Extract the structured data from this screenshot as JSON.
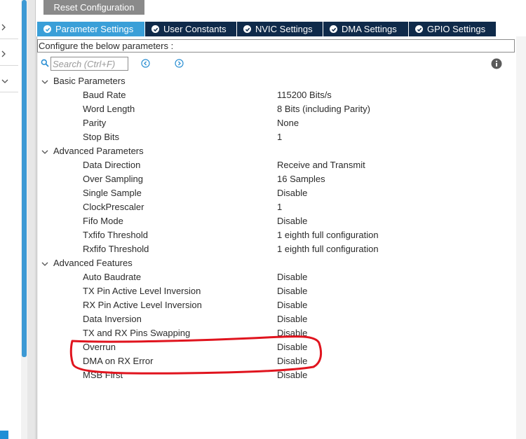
{
  "toolbar": {
    "reset_label": "Reset Configuration"
  },
  "tabs": [
    {
      "label": "Parameter Settings",
      "active": true
    },
    {
      "label": "User Constants",
      "active": false
    },
    {
      "label": "NVIC Settings",
      "active": false
    },
    {
      "label": "DMA Settings",
      "active": false
    },
    {
      "label": "GPIO Settings",
      "active": false
    }
  ],
  "description": "Configure the below parameters :",
  "search": {
    "placeholder": "Search (Ctrl+F)",
    "value": ""
  },
  "groups": [
    {
      "label": "Basic Parameters",
      "params": [
        {
          "name": "Baud Rate",
          "value": "115200 Bits/s"
        },
        {
          "name": "Word Length",
          "value": "8 Bits (including Parity)"
        },
        {
          "name": "Parity",
          "value": "None"
        },
        {
          "name": "Stop Bits",
          "value": "1"
        }
      ]
    },
    {
      "label": "Advanced Parameters",
      "params": [
        {
          "name": "Data Direction",
          "value": "Receive and Transmit"
        },
        {
          "name": "Over Sampling",
          "value": "16 Samples"
        },
        {
          "name": "Single Sample",
          "value": "Disable"
        },
        {
          "name": "ClockPrescaler",
          "value": "1"
        },
        {
          "name": "Fifo Mode",
          "value": "Disable"
        },
        {
          "name": "Txfifo Threshold",
          "value": "1 eighth full configuration"
        },
        {
          "name": "Rxfifo Threshold",
          "value": "1 eighth full configuration"
        }
      ]
    },
    {
      "label": "Advanced Features",
      "params": [
        {
          "name": "Auto Baudrate",
          "value": "Disable"
        },
        {
          "name": "TX Pin Active Level Inversion",
          "value": "Disable"
        },
        {
          "name": "RX Pin Active Level Inversion",
          "value": "Disable"
        },
        {
          "name": "Data Inversion",
          "value": "Disable"
        },
        {
          "name": "TX and RX Pins Swapping",
          "value": "Disable"
        },
        {
          "name": "Overrun",
          "value": "Disable"
        },
        {
          "name": "DMA on RX Error",
          "value": "Disable"
        },
        {
          "name": "MSB First",
          "value": "Disable"
        }
      ]
    }
  ],
  "icons": {
    "search": "search-icon",
    "prev": "arrow-left-circle-icon",
    "next": "arrow-right-circle-icon",
    "info": "info-icon",
    "expand": "chevron-down-icon",
    "tab_check": "check-circle-icon"
  },
  "colors": {
    "tab_active": "#3a9fd8",
    "tab_inactive": "#0f2a4a",
    "reset_button": "#8a8a8a",
    "annotation": "#e0141e",
    "accent": "#3c99d4"
  }
}
